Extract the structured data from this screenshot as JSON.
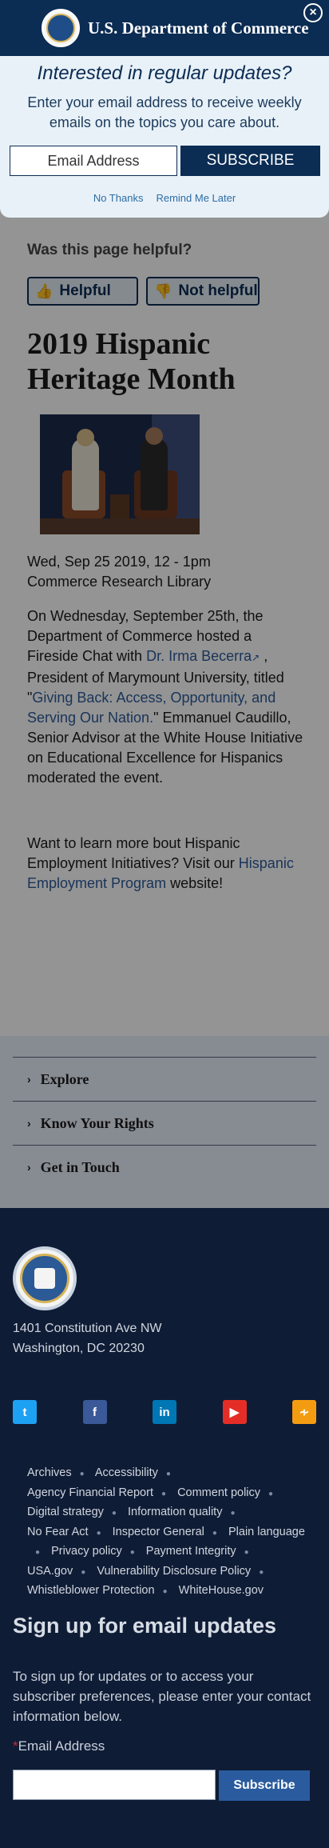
{
  "header": {
    "title": "U.S. Department of Commerce",
    "close_symbol": "×"
  },
  "modal": {
    "heading": "Interested in regular updates?",
    "text": "Enter your email address to receive weekly emails on the topics you care about.",
    "email_placeholder": "Email Address",
    "subscribe_label": "SUBSCRIBE",
    "no_thanks": "No Thanks",
    "remind_later": "Remind Me Later"
  },
  "feedback": {
    "question": "Was this page helpful?",
    "yes_label": "Helpful",
    "no_label": "Not helpful"
  },
  "article": {
    "title": "2019 Hispanic Heritage Month",
    "date": "Wed, Sep 25 2019, 12 - 1pm",
    "location": "Commerce Research Library",
    "body_1": "On Wednesday, September 25th, the Department of Commerce hosted a Fireside Chat with",
    "link_person": "Dr. Irma Becerra",
    "body_2": ", President of Marymount University, titled \"",
    "link_title": "Giving Back: Access, Opportunity, and Serving Our Nation.",
    "body_3": "\" Emmanuel Caudillo, Senior Advisor at the White House Initiative on Educational Excellence for Hispanics moderated the event.",
    "more_1": "Want to learn more bout Hispanic Employment Initiatives? Visit our",
    "more_link": "Hispanic Employment Program",
    "more_2": "website!"
  },
  "accordion": {
    "items": [
      {
        "label": "Explore"
      },
      {
        "label": "Know Your Rights"
      },
      {
        "label": "Get in Touch"
      }
    ]
  },
  "footer": {
    "address_line1": "1401 Constitution Ave NW",
    "address_line2": "Washington, DC 20230",
    "social": [
      "twitter-icon",
      "facebook-icon",
      "linkedin-icon",
      "youtube-icon",
      "rss-icon"
    ],
    "links": [
      "Archives",
      "Accessibility",
      "Agency Financial Report",
      "Comment policy",
      "Digital strategy",
      "Information quality",
      "No Fear Act",
      "Inspector General",
      "Plain language",
      "Privacy policy",
      "Payment Integrity",
      "USA.gov",
      "Vulnerability Disclosure Policy",
      "Whistleblower Protection",
      "WhiteHouse.gov"
    ],
    "signup_title": "Sign up for email updates",
    "signup_text": "To sign up for updates or to access your subscriber preferences, please enter your contact information below.",
    "required_mark": "*",
    "field_label": "Email Address",
    "subscribe_label": "Subscribe"
  },
  "colors": {
    "brand_navy": "#0b2c53",
    "footer_bg": "#0f1c36",
    "link_blue": "#2e5b9a"
  }
}
